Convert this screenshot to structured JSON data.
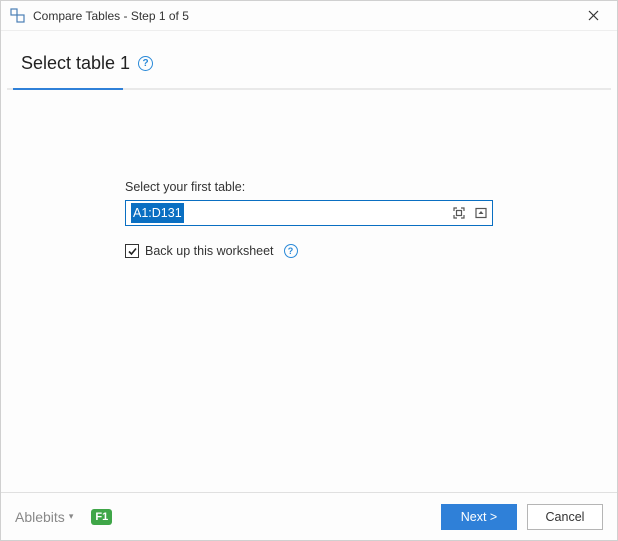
{
  "titlebar": {
    "title": "Compare Tables - Step 1 of 5"
  },
  "heading": {
    "text": "Select table 1"
  },
  "form": {
    "field_label": "Select your first table:",
    "range_value": "A1:D131",
    "backup_label": "Back up this worksheet",
    "backup_checked": true
  },
  "footer": {
    "brand": "Ablebits",
    "f1": "F1",
    "next_label": "Next >",
    "cancel_label": "Cancel"
  }
}
